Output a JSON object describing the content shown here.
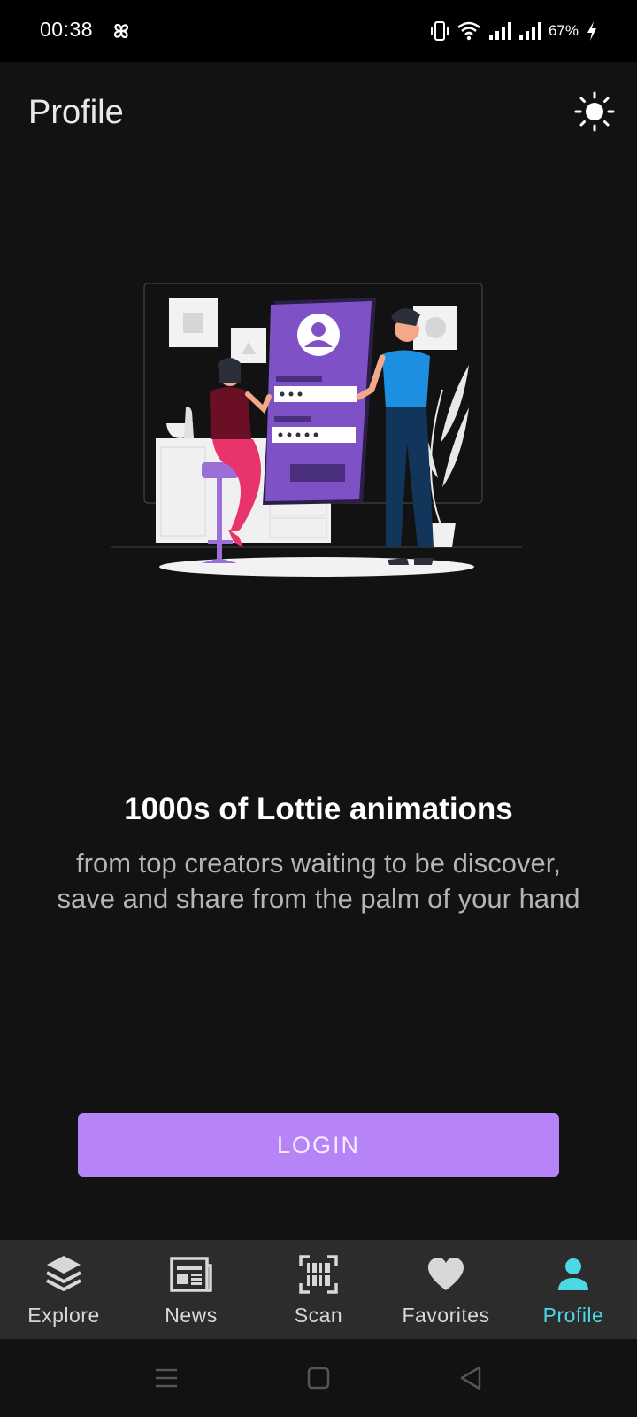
{
  "status_bar": {
    "time": "00:38",
    "battery": "67%"
  },
  "header": {
    "title": "Profile",
    "theme_toggle_icon": "sun-icon"
  },
  "promo": {
    "title": "1000s of Lottie animations",
    "description": "from top creators waiting to be discover, save and share from the palm of your hand"
  },
  "login": {
    "label": "LOGIN"
  },
  "bottom_nav": {
    "items": [
      {
        "label": "Explore",
        "icon": "layers-icon"
      },
      {
        "label": "News",
        "icon": "newspaper-icon"
      },
      {
        "label": "Scan",
        "icon": "barcode-scan-icon"
      },
      {
        "label": "Favorites",
        "icon": "heart-icon"
      },
      {
        "label": "Profile",
        "icon": "person-icon"
      }
    ],
    "active": "Profile"
  },
  "colors": {
    "accent": "#b684f7",
    "active_nav": "#4dd8e6",
    "background": "#121212",
    "nav_background": "#2c2c2c"
  }
}
